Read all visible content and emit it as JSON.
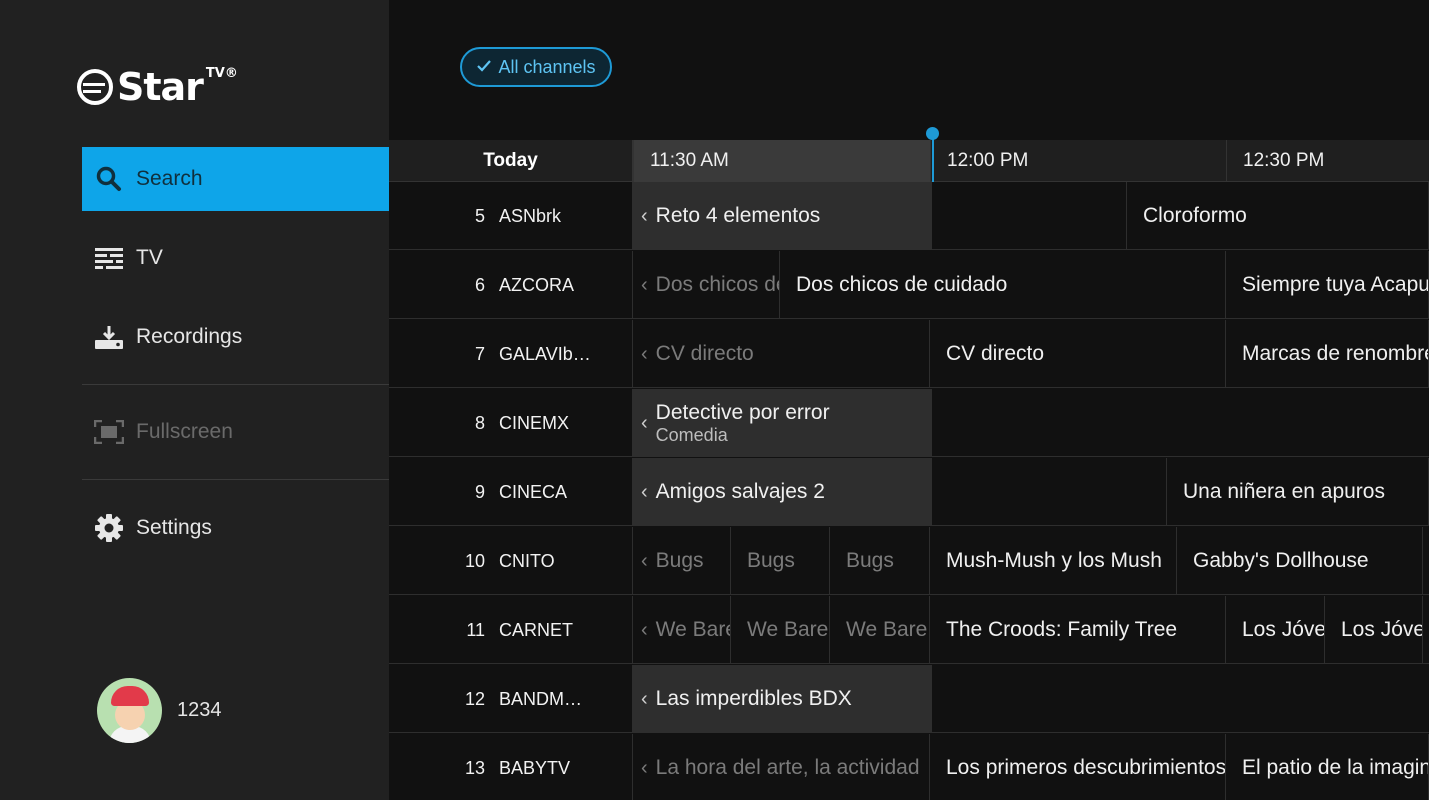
{
  "brand": {
    "name": "Star",
    "sup": "TV®"
  },
  "nav": {
    "search": "Search",
    "tv": "TV",
    "recordings": "Recordings",
    "fullscreen": "Fullscreen",
    "settings": "Settings"
  },
  "profile": {
    "name": "1234"
  },
  "filter": {
    "label": "All channels"
  },
  "guide": {
    "day": "Today",
    "times": [
      "11:30 AM",
      "12:00 PM",
      "12:30 PM"
    ],
    "rows": [
      {
        "num": "5",
        "name": "ASNbrk",
        "progs": [
          "Reto 4 elementos",
          "",
          "Cloroformo"
        ]
      },
      {
        "num": "6",
        "name": "AZCORA",
        "progs": [
          "Dos chicos de cuidado",
          "Dos chicos de cuidado",
          "Siempre tuya Acapulco"
        ]
      },
      {
        "num": "7",
        "name": "GALAVIb…",
        "progs": [
          "CV directo",
          "CV directo",
          "Marcas de renombre"
        ]
      },
      {
        "num": "8",
        "name": "CINEMX",
        "progs": [
          "Detective por error"
        ],
        "sub": "Comedia"
      },
      {
        "num": "9",
        "name": "CINECA",
        "progs": [
          "Amigos salvajes 2",
          "",
          "Una niñera en apuros"
        ]
      },
      {
        "num": "10",
        "name": "CNITO",
        "progs": [
          "Bugs",
          "Bugs",
          "Bugs",
          "Mush-Mush y los Mush",
          "Gabby's Dollhouse"
        ]
      },
      {
        "num": "11",
        "name": "CARNET",
        "progs": [
          "We Bare",
          "We Bare",
          "We Bare",
          "The Croods: Family Tree",
          "Los Jóvenes",
          "Los Jóvenes"
        ]
      },
      {
        "num": "12",
        "name": "BANDM…",
        "progs": [
          "Las imperdibles BDX"
        ]
      },
      {
        "num": "13",
        "name": "BABYTV",
        "progs": [
          "La hora del arte, la actividad",
          "Los primeros descubrimientos",
          "El patio de la imaginación"
        ]
      }
    ]
  },
  "colors": {
    "accent": "#0ea5e9",
    "timeline": "#1e9ad6"
  },
  "icons": {
    "search": "search-icon",
    "tv": "tv-guide-icon",
    "recordings": "download-icon",
    "fullscreen": "fullscreen-icon",
    "settings": "gear-icon"
  }
}
